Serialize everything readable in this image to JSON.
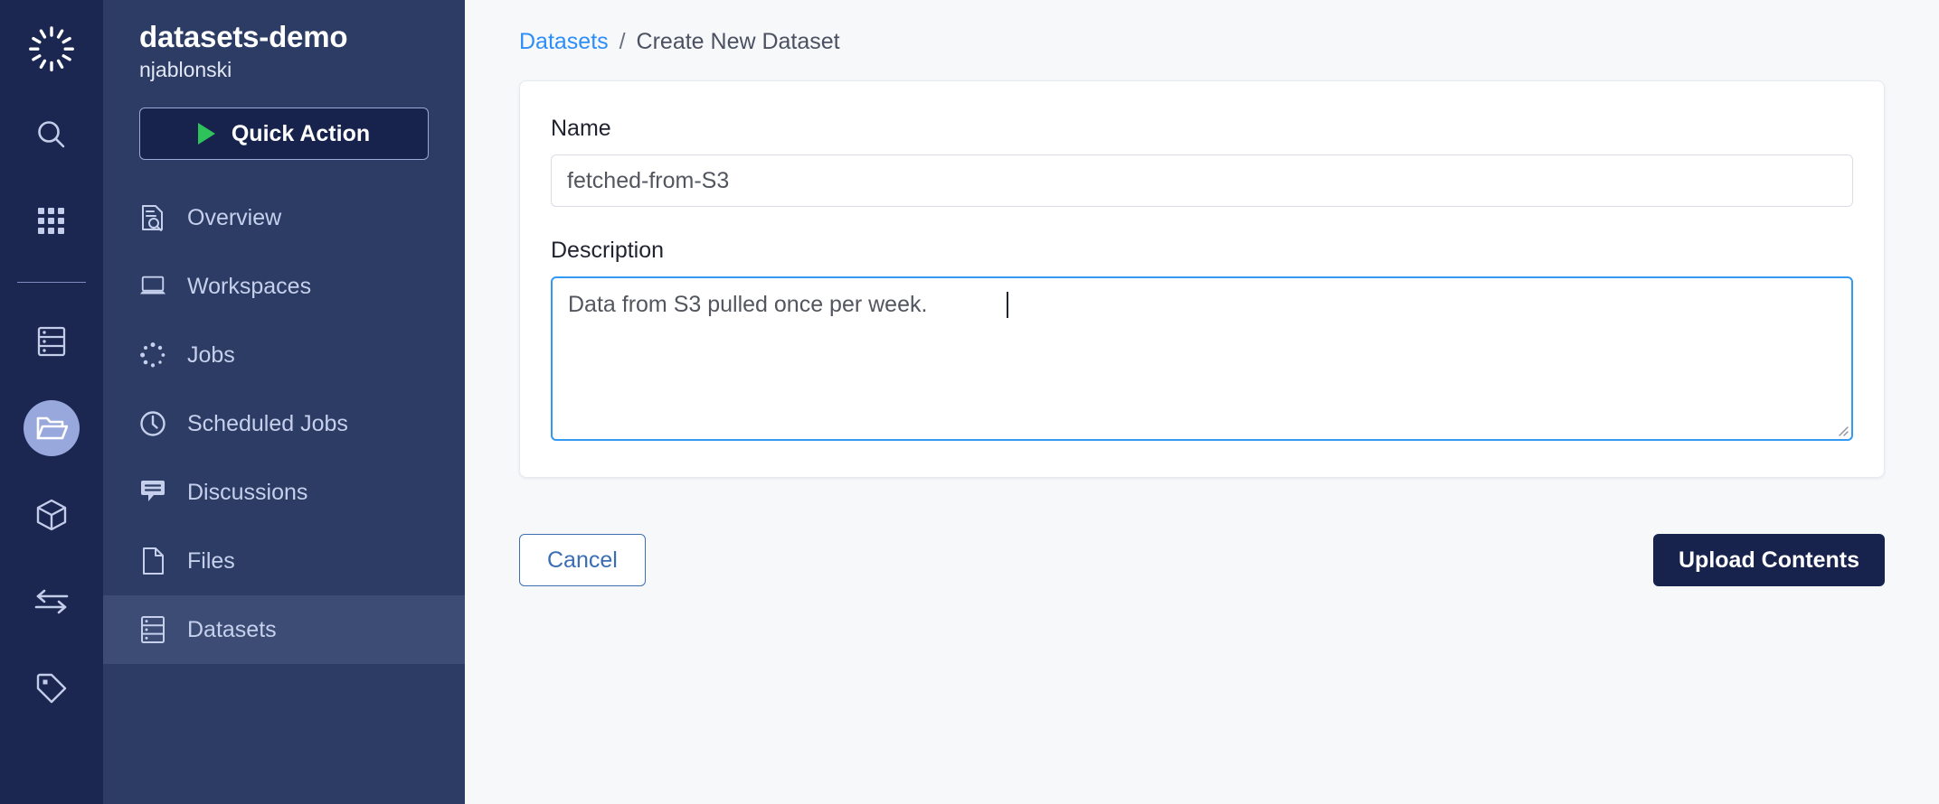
{
  "colors": {
    "rail_bg": "#1b2651",
    "sidebar_bg": "#2d3c65",
    "sidebar_active": "#3d4c75",
    "accent_link": "#2c8ef8",
    "focus_border": "#3399f3",
    "primary_button": "#17234d",
    "play_green": "#2fc25b",
    "rail_active_circle": "#98a8dd",
    "main_bg": "#f7f8fa"
  },
  "rail": {
    "logo": "domino-logo-icon",
    "items": [
      {
        "name": "search-icon",
        "label": "Search",
        "active": false
      },
      {
        "name": "grid-apps-icon",
        "label": "Apps",
        "active": false
      },
      {
        "name": "server-icon",
        "label": "Environments",
        "active": false
      },
      {
        "name": "folder-open-icon",
        "label": "Projects",
        "active": true
      },
      {
        "name": "cube-icon",
        "label": "Models",
        "active": false
      },
      {
        "name": "transfer-arrows-icon",
        "label": "Transfers",
        "active": false
      },
      {
        "name": "tag-icon",
        "label": "Tags",
        "active": false
      }
    ]
  },
  "sidebar": {
    "project_name": "datasets-demo",
    "owner": "njablonski",
    "quick_action_label": "Quick Action",
    "quick_action_icon": "play-icon",
    "items": [
      {
        "label": "Overview",
        "icon": "document-search-icon",
        "active": false
      },
      {
        "label": "Workspaces",
        "icon": "laptop-icon",
        "active": false
      },
      {
        "label": "Jobs",
        "icon": "spinner-dots-icon",
        "active": false
      },
      {
        "label": "Scheduled Jobs",
        "icon": "clock-icon",
        "active": false
      },
      {
        "label": "Discussions",
        "icon": "chat-bubble-icon",
        "active": false
      },
      {
        "label": "Files",
        "icon": "file-icon",
        "active": false
      },
      {
        "label": "Datasets",
        "icon": "datasets-stack-icon",
        "active": true
      }
    ]
  },
  "breadcrumb": {
    "link": "Datasets",
    "separator": "/",
    "current": "Create New Dataset"
  },
  "form": {
    "name_label": "Name",
    "name_value": "fetched-from-S3",
    "name_placeholder": "fetched-from-S3",
    "description_label": "Description",
    "description_value": "Data from S3 pulled once per week.",
    "description_placeholder": "Data from S3 pulled once per week.",
    "description_focused": true
  },
  "actions": {
    "cancel_label": "Cancel",
    "upload_label": "Upload Contents"
  }
}
